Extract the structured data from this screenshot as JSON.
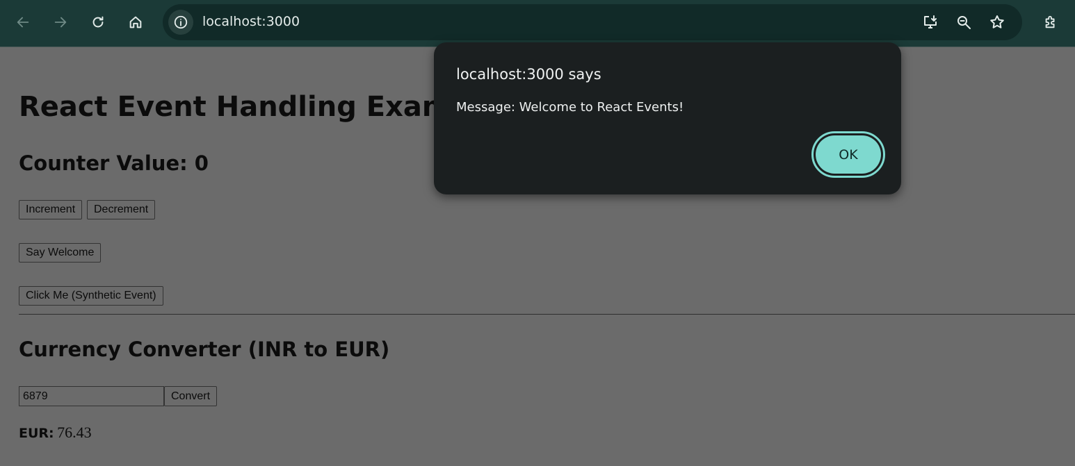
{
  "browser": {
    "url": "localhost:3000",
    "icons": {
      "back": "arrow-left-icon",
      "forward": "arrow-right-icon",
      "reload": "reload-icon",
      "home": "home-icon",
      "site_info": "info-icon",
      "install": "install-app-icon",
      "zoom": "zoom-icon",
      "bookmark": "star-icon",
      "extensions": "puzzle-icon"
    },
    "colors": {
      "toolbar": "#1b3a37",
      "omnibox": "#112a28"
    }
  },
  "page": {
    "title": "React Event Handling Example",
    "counter_label": "Counter Value: 0",
    "increment_label": "Increment",
    "decrement_label": "Decrement",
    "welcome_label": "Say Welcome",
    "synthetic_label": "Click Me (Synthetic Event)",
    "converter_title": "Currency Converter (INR to EUR)",
    "amount_value": "6879",
    "convert_label": "Convert",
    "result_label": "EUR:",
    "result_value": "76.43"
  },
  "dialog": {
    "title": "localhost:3000 says",
    "message": "Message: Welcome to React Events!",
    "ok_label": "OK",
    "accent_color": "#7ed9cf"
  }
}
